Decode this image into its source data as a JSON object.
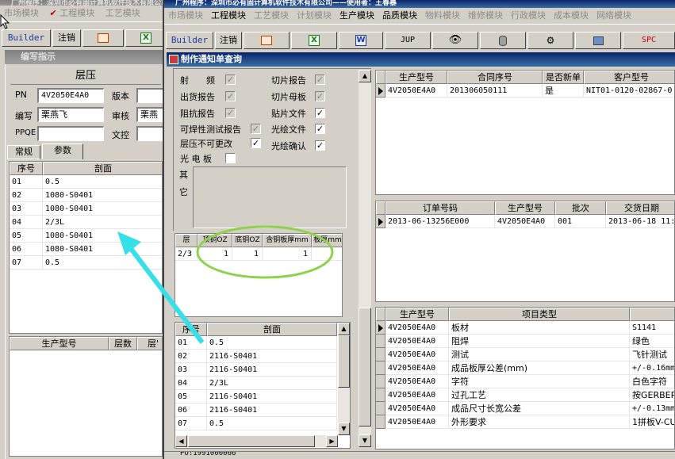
{
  "back": {
    "title": "广州程序：深圳市必有固计算机软件技术有限公司",
    "menu": [
      "市场模块",
      "工程模块",
      "工艺模块"
    ],
    "builder": "Builder",
    "logout": "注销",
    "subtitle": "编写指示",
    "section": "层压",
    "pn_label": "PN",
    "pn_value": "4V2050E4A0",
    "ver_label": "版本",
    "editor_label": "编写",
    "editor_value": "栗燕飞",
    "review_label": "审核",
    "review_value": "栗燕",
    "ppqe_label": "PPQE",
    "doc_label": "文控",
    "tabs": [
      "常规",
      "参数"
    ],
    "table": {
      "headers": [
        "序号",
        "剖面"
      ],
      "rows": [
        [
          "01",
          "0.5"
        ],
        [
          "02",
          "1080-S0401"
        ],
        [
          "03",
          "1080-S0401"
        ],
        [
          "04",
          "2/3L"
        ],
        [
          "05",
          "1080-S0401"
        ],
        [
          "06",
          "1080-S0401"
        ],
        [
          "07",
          "0.5"
        ]
      ]
    },
    "bottom_headers": [
      "生产型号",
      "层数",
      "层'"
    ]
  },
  "front": {
    "title": "广州程序：深圳市必有固计算机软件技术有限公司——使用者：王春暴",
    "menu": [
      "市场模块",
      "工程模块",
      "工艺模块",
      "计划模块",
      "生产模块",
      "品质模块",
      "物料模块",
      "维修模块",
      "行政模块",
      "成本模块",
      "网络模块"
    ],
    "builder": "Builder",
    "logout": "注销",
    "jup": "JUP",
    "spc": "SPC",
    "subtitle": "制作通知单查询",
    "checks": [
      {
        "label": "射　　频",
        "checked": true,
        "disabled": true
      },
      {
        "label": "出货报告",
        "checked": true,
        "disabled": true
      },
      {
        "label": "阻抗报告",
        "checked": true,
        "disabled": true
      },
      {
        "label": "可焊性测试报告",
        "checked": true,
        "disabled": true
      },
      {
        "label": "层压不可更改",
        "checked": true,
        "disabled": false
      },
      {
        "label": "光 电 板",
        "checked": false,
        "disabled": false
      }
    ],
    "checks2": [
      {
        "label": "切片报告",
        "checked": true,
        "disabled": true
      },
      {
        "label": "切片母板",
        "checked": true,
        "disabled": true
      },
      {
        "label": "贴片文件",
        "checked": true,
        "disabled": false
      },
      {
        "label": "光绘文件",
        "checked": true,
        "disabled": false
      },
      {
        "label": "光绘确认",
        "checked": true,
        "disabled": false
      }
    ],
    "other_label": "其它",
    "layer_table": {
      "headers": [
        "层",
        "顶铜OZ",
        "底铜OZ",
        "含铜板厚mm",
        "板厚mm"
      ],
      "row": [
        "2/3",
        "1",
        "1",
        "1",
        ""
      ]
    },
    "profile_table": {
      "headers": [
        "序号",
        "剖面"
      ],
      "rows": [
        [
          "01",
          "0.5"
        ],
        [
          "02",
          "2116-S0401"
        ],
        [
          "03",
          "2116-S0401"
        ],
        [
          "04",
          "2/3L"
        ],
        [
          "05",
          "2116-S0401"
        ],
        [
          "06",
          "2116-S0401"
        ],
        [
          "07",
          "0.5"
        ]
      ]
    },
    "contract_table": {
      "headers": [
        "生产型号",
        "合同序号",
        "是否新单",
        "客户型号"
      ],
      "row": [
        "4V2050E4A0",
        "201306050111",
        "是",
        "NIT01-0120-02867-0"
      ]
    },
    "order_table": {
      "headers": [
        "订单号码",
        "生产型号",
        "批次",
        "交货日期"
      ],
      "row": [
        "2013-06-13256E000",
        "4V2050E4A0",
        "001",
        "2013-06-18 11:"
      ]
    },
    "item_table": {
      "headers": [
        "生产型号",
        "项目类型",
        ""
      ],
      "rows": [
        [
          "4V2050E4A0",
          "板材",
          "S1141"
        ],
        [
          "4V2050E4A0",
          "阻焊",
          "绿色"
        ],
        [
          "4V2050E4A0",
          "测试",
          "飞针测试"
        ],
        [
          "4V2050E4A0",
          "成品板厚公差(mm)",
          "+/-0.16mm"
        ],
        [
          "4V2050E4A0",
          "字符",
          "白色字符"
        ],
        [
          "4V2050E4A0",
          "过孔工艺",
          "按GERBER文"
        ],
        [
          "4V2050E4A0",
          "成品尺寸长宽公差",
          "+/-0.13mm"
        ],
        [
          "4V2050E4A0",
          "外形要求",
          "1拼板V-CU"
        ]
      ]
    },
    "status": "PO:1991000066"
  },
  "colors": {
    "title_active": "#0a246a",
    "highlight_circle": "#8fd14f",
    "arrow": "#35e0e8"
  }
}
